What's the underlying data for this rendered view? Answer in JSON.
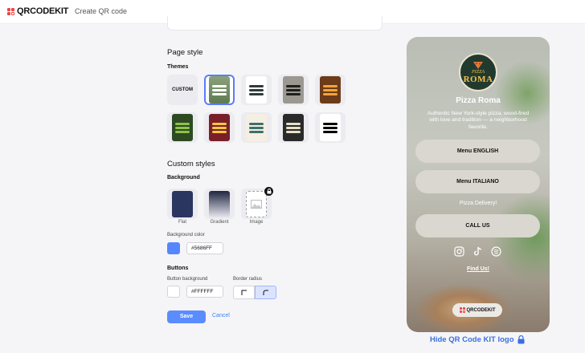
{
  "header": {
    "logo_text": "QRCODEKIT",
    "breadcrumb": "Create QR code"
  },
  "page_style": {
    "title": "Page style",
    "themes_label": "Themes",
    "custom_label": "CUSTOM"
  },
  "custom_styles": {
    "title": "Custom styles",
    "background_label": "Background",
    "options": [
      "Flat",
      "Gradient",
      "Image"
    ],
    "bg_color_label": "Background color",
    "bg_color_value": "#5686FF",
    "buttons_label": "Buttons",
    "button_bg_label": "Button background",
    "button_bg_value": "#FFFFFF",
    "border_radius_label": "Border radius"
  },
  "actions": {
    "save": "Save",
    "cancel": "Cancel"
  },
  "preview": {
    "logo_small": "PIZZA",
    "logo_big": "ROMA",
    "name": "Pizza Roma",
    "description": "Authentic New York-style pizza, wood-fired with love and tradition — a neighborhood favorite.",
    "buttons": [
      "Menu ENGLISH",
      "Menu ITALIANO"
    ],
    "delivery_text": "Pizza Delivery!",
    "call_button": "CALL US",
    "find_us": "Find Us!",
    "footer_logo": "QRCODEKIT",
    "socials": [
      "instagram-icon",
      "tiktok-icon",
      "spotify-icon"
    ]
  },
  "hide_logo": "Hide QR Code KIT logo",
  "colors": {
    "accent": "#5b8cff",
    "selected": "#5b7cfa",
    "link": "#3b6fe0"
  }
}
